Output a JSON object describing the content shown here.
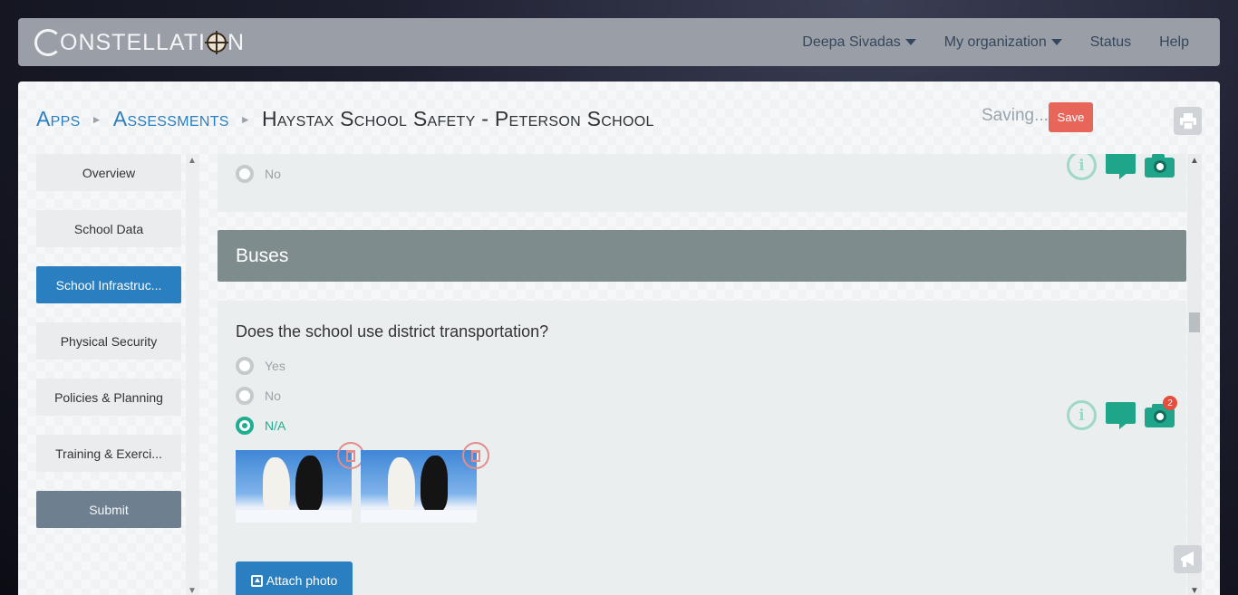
{
  "navbar": {
    "logo_text_1": "ONSTELLATI",
    "logo_text_2": "N",
    "menu": {
      "user": "Deepa Sivadas",
      "org": "My organization",
      "status": "Status",
      "help": "Help"
    }
  },
  "breadcrumb": {
    "apps": "Apps",
    "assessments": "Assessments",
    "current": "Haystax School Safety - Peterson School"
  },
  "toolbar": {
    "saving_text": "Saving...",
    "save_label": "Save"
  },
  "sidebar": {
    "items": [
      {
        "label": "Overview"
      },
      {
        "label": "School Data"
      },
      {
        "label": "School Infrastruc..."
      },
      {
        "label": "Physical Security"
      },
      {
        "label": "Policies & Planning"
      },
      {
        "label": "Training & Exerci..."
      }
    ],
    "submit_label": "Submit",
    "active_index": 2
  },
  "content": {
    "prev_option": "No",
    "section_title": "Buses",
    "question": "Does the school use district transportation?",
    "options": [
      "Yes",
      "No",
      "N/A"
    ],
    "selected_option": "N/A",
    "photo_count_badge": "2",
    "attach_label": "Attach photo"
  },
  "colors": {
    "accent_blue": "#2a7fc1",
    "accent_teal": "#1fa58a",
    "save_red": "#e8655a",
    "section_gray": "#7f8c8d"
  },
  "icons": [
    "chevron-down-icon",
    "compass-icon",
    "print-icon",
    "info-icon",
    "comment-icon",
    "camera-icon",
    "trash-icon",
    "upload-icon",
    "megaphone-icon"
  ]
}
